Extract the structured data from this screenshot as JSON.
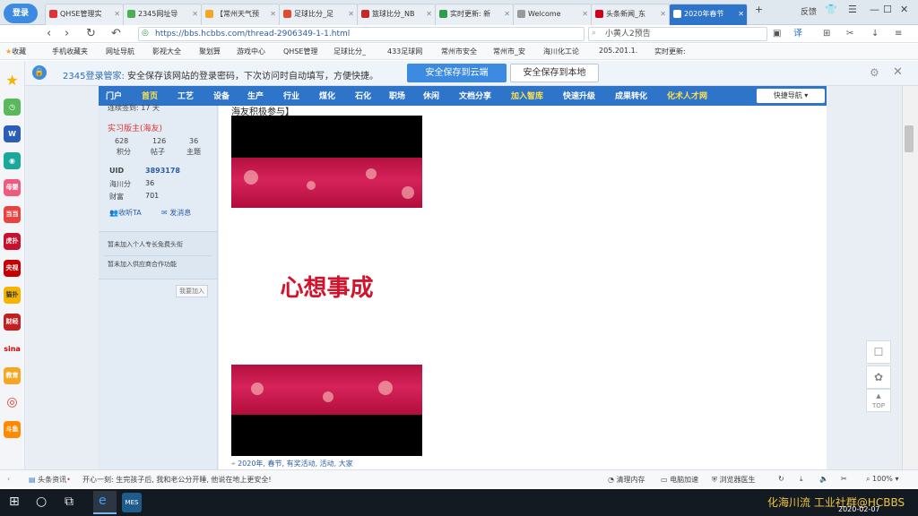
{
  "tabs": [
    {
      "label": "QHSE管理实"
    },
    {
      "label": "2345网址导"
    },
    {
      "label": "【常州天气预"
    },
    {
      "label": "足球比分_足"
    },
    {
      "label": "篮球比分_NB"
    },
    {
      "label": "实时更新: 新"
    },
    {
      "label": "Welcome"
    },
    {
      "label": "头条新闻_东"
    },
    {
      "label": "2020年春节"
    }
  ],
  "login_label": "登录",
  "feedback_label": "反馈",
  "address": {
    "url": "https://bbs.hcbbs.com/thread-2906349-1-1.html",
    "search_text": "小黄人2预告"
  },
  "bookmarks": [
    "收藏",
    "手机收藏夹",
    "网址导航",
    "影视大全",
    "聚划算",
    "游戏中心",
    "QHSE管理",
    "足球比分_",
    "433足球网",
    "常州市安全",
    "常州市_安",
    "海川化工论",
    "205.201.1.",
    "实时更新:"
  ],
  "password_bar": {
    "brand": "2345登录管家:",
    "message": "安全保存该网站的登录密码，下次访问时自动填写，方便快捷。",
    "save_cloud": "安全保存到云端",
    "save_local": "安全保存到本地"
  },
  "sidebar_icons": [
    "母婴",
    "当当",
    "虎扑",
    "央视",
    "猫扑",
    "财经",
    "sina",
    "教育",
    "斗鱼"
  ],
  "site_nav": {
    "items": [
      "门户",
      "首页",
      "工艺",
      "设备",
      "生产",
      "行业",
      "煤化",
      "石化",
      "职场",
      "休闲",
      "文档分享",
      "加入智库",
      "快速升级",
      "成果转化",
      "化术人才网"
    ],
    "quick_nav": "快捷导航"
  },
  "profile": {
    "sign_days": "连续签到: 17 天",
    "role": "实习版主(海友)",
    "stats": [
      {
        "value": "628",
        "label": "积分"
      },
      {
        "value": "126",
        "label": "帖子"
      },
      {
        "value": "36",
        "label": "主题"
      }
    ],
    "uid_label": "UID",
    "uid": "3893178",
    "haichuan_label": "海川分",
    "haichuan": "36",
    "wealth_label": "财富",
    "wealth": "701",
    "listen": "收听TA",
    "message": "发消息",
    "join_expert": "暂未加入个人专长免费头衔",
    "join_supplier": "暂未加入供应商合作功能",
    "apply": "我要加入"
  },
  "post": {
    "intro": "海友积极参与】",
    "slogan": "心想事成",
    "tags": "2020年, 春节, 有奖活动, 活动, 大家"
  },
  "statusbar": {
    "news_label": "头条资讯",
    "ticker": "开心一刻: 生完孩子后, 我和老公分开睡, 他说在地上更安全!",
    "clean": "清理内存",
    "speedup": "电脑加速",
    "doctor": "浏览器医生",
    "zoom": "100%"
  },
  "taskbar": {
    "watermark": "化海川流 工业社群@HCBBS",
    "date": "2020-02-07"
  }
}
